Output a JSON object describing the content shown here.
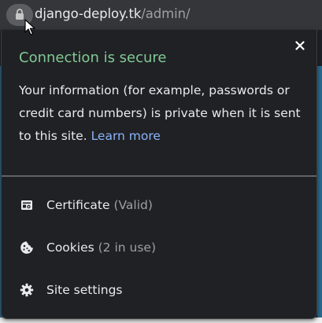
{
  "omnibox": {
    "domain": "django-deploy.tk",
    "path": "/admin/"
  },
  "popup": {
    "title": "Connection is secure",
    "description": "Your information (for example, passwords or credit card numbers) is private when it is sent to this site.",
    "learn_more": "Learn more",
    "items": [
      {
        "label": "Certificate",
        "detail": "(Valid)",
        "icon": "certificate-icon"
      },
      {
        "label": "Cookies",
        "detail": "(2 in use)",
        "icon": "cookie-icon"
      },
      {
        "label": "Site settings",
        "detail": "",
        "icon": "gear-icon"
      }
    ]
  },
  "colors": {
    "secure_title": "#81c995",
    "link": "#8ab4f8",
    "popup_bg": "#202124",
    "text": "#e8eaed",
    "muted": "#9aa0a6"
  }
}
